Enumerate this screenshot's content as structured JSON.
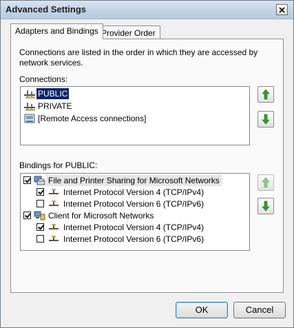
{
  "window": {
    "title": "Advanced Settings"
  },
  "tabs": [
    {
      "label": "Adapters and Bindings",
      "active": true
    },
    {
      "label": "Provider Order",
      "active": false
    }
  ],
  "description": "Connections are listed in the order in which they are accessed by network services.",
  "connections": {
    "label": "Connections:",
    "items": [
      {
        "label": "PUBLIC",
        "icon": "network-adapter-icon",
        "selected": true
      },
      {
        "label": "PRIVATE",
        "icon": "network-adapter-icon",
        "selected": false
      },
      {
        "label": "[Remote Access connections]",
        "icon": "remote-access-icon",
        "selected": false
      }
    ]
  },
  "bindings": {
    "label": "Bindings for PUBLIC:",
    "items": [
      {
        "label": "File and Printer Sharing for Microsoft Networks",
        "checked": true,
        "level": 0,
        "icon": "file-printer-sharing-icon"
      },
      {
        "label": "Internet Protocol Version 4 (TCP/IPv4)",
        "checked": true,
        "level": 1,
        "icon": "protocol-icon"
      },
      {
        "label": "Internet Protocol Version 6 (TCP/IPv6)",
        "checked": false,
        "level": 1,
        "icon": "protocol-icon"
      },
      {
        "label": "Client for Microsoft Networks",
        "checked": true,
        "level": 0,
        "icon": "client-network-icon"
      },
      {
        "label": "Internet Protocol Version 4 (TCP/IPv4)",
        "checked": true,
        "level": 1,
        "icon": "protocol-icon"
      },
      {
        "label": "Internet Protocol Version 6 (TCP/IPv6)",
        "checked": false,
        "level": 1,
        "icon": "protocol-icon"
      }
    ]
  },
  "buttons": {
    "ok": "OK",
    "cancel": "Cancel"
  },
  "colors": {
    "arrow_green": "#2e9e2e",
    "arrow_disabled": "#8fc98f",
    "selection": "#0a246a"
  }
}
